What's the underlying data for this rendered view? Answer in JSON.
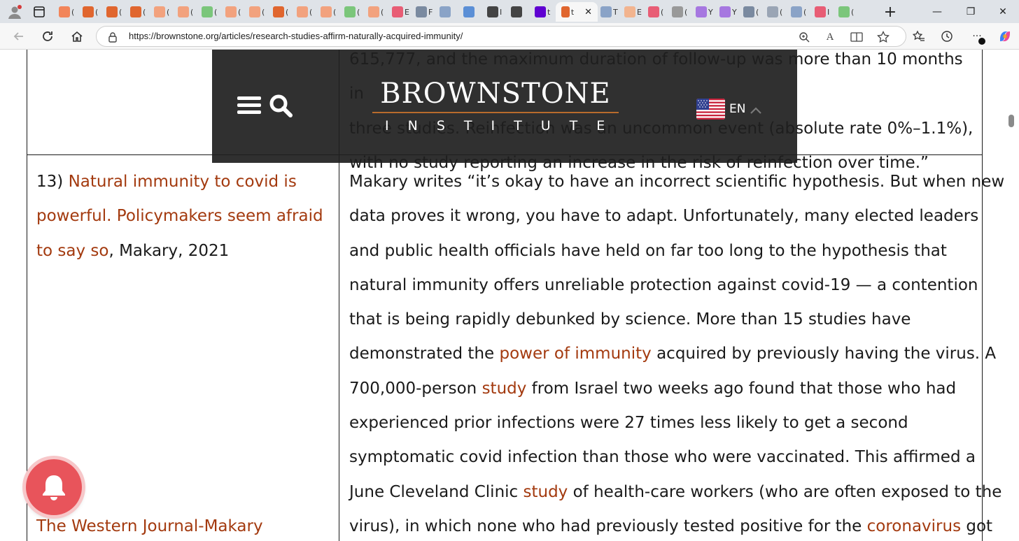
{
  "browser": {
    "tabs": [
      {
        "icon": "bookmark-icon",
        "color": "#f2855a",
        "label": "("
      },
      {
        "icon": "bookmark-icon",
        "color": "#e0662f",
        "label": "("
      },
      {
        "icon": "bookmark-icon",
        "color": "#e0662f",
        "label": "("
      },
      {
        "icon": "bookmark-icon",
        "color": "#e0662f",
        "label": "("
      },
      {
        "icon": "bookmark-icon",
        "color": "#f2a27e",
        "label": "("
      },
      {
        "icon": "bookmark-icon",
        "color": "#f2a27e",
        "label": "("
      },
      {
        "icon": "play-icon",
        "color": "#7bc67b",
        "label": "("
      },
      {
        "icon": "bookmark-icon",
        "color": "#f2a27e",
        "label": "("
      },
      {
        "icon": "bookmark-icon",
        "color": "#f2a27e",
        "label": "("
      },
      {
        "icon": "bookmark-icon",
        "color": "#e0662f",
        "label": "("
      },
      {
        "icon": "bookmark-icon",
        "color": "#f2a27e",
        "label": "("
      },
      {
        "icon": "bookmark-icon",
        "color": "#f2a27e",
        "label": "("
      },
      {
        "icon": "play-icon",
        "color": "#7bc67b",
        "label": "("
      },
      {
        "icon": "bookmark-icon",
        "color": "#f2a27e",
        "label": "("
      },
      {
        "icon": "video-icon",
        "color": "#e85d75",
        "label": "E"
      },
      {
        "icon": "news-icon",
        "color": "#7a8aa0",
        "label": "F"
      },
      {
        "icon": "doc-icon",
        "color": "#8aa3c7",
        "label": ""
      },
      {
        "icon": "search-icon",
        "color": "#5b8fd6",
        "label": ""
      },
      {
        "icon": "slash-icon",
        "color": "#444444",
        "label": "I"
      },
      {
        "icon": "slash-icon",
        "color": "#444444",
        "label": ""
      },
      {
        "icon": "yahoo-icon",
        "color": "#5f01d1",
        "label": "t"
      }
    ],
    "active_tab": {
      "icon": "bookmark-icon",
      "label": "t",
      "close": "✕"
    },
    "tabs_after": [
      {
        "icon": "gp-icon",
        "color": "#8aa3c7",
        "label": "T"
      },
      {
        "icon": "bookmark-icon",
        "color": "#f2b48f",
        "label": "E"
      },
      {
        "icon": "video-icon",
        "color": "#e85d75",
        "label": "("
      },
      {
        "icon": "face-icon",
        "color": "#999999",
        "label": "("
      },
      {
        "icon": "yahoo-icon",
        "color": "#a677e0",
        "label": "Y"
      },
      {
        "icon": "yahoo-icon",
        "color": "#a677e0",
        "label": "Y"
      },
      {
        "icon": "news-icon",
        "color": "#7a8aa0",
        "label": "("
      },
      {
        "icon": "doc-icon",
        "color": "#9aa5b5",
        "label": "("
      },
      {
        "icon": "web-icon",
        "color": "#8aa3c7",
        "label": "("
      },
      {
        "icon": "video-icon",
        "color": "#e85d75",
        "label": "I"
      },
      {
        "icon": "play-icon",
        "color": "#7bc67b",
        "label": "("
      }
    ],
    "new_tab": "+",
    "window_controls": {
      "minimize": "—",
      "restore": "❐",
      "close": "✕"
    },
    "url": "https://brownstone.org/articles/research-studies-affirm-naturally-acquired-immunity/"
  },
  "site": {
    "logo_word": "BROWNSTONE",
    "logo_sub": "INSTITUTE",
    "language": "EN",
    "accent_color": "#a33a0f"
  },
  "article": {
    "prev_row_text_lines": [
      "615,777, and the maximum duration of follow-up was more than 10 months in",
      "three studies. Reinfection was an uncommon event (absolute rate 0%–1.1%),",
      "with no study reporting an increase in the risk of reinfection over time.”"
    ],
    "row13": {
      "number": "13)",
      "title_link_lines": [
        "Natural immunity to covid is",
        "powerful. Policymakers seem afraid",
        "to say so"
      ],
      "citation": ", Makary, 2021",
      "footer_link": "The Western Journal-Makary",
      "body": [
        [
          {
            "t": "Makary writes “it’s okay to have an incorrect scientific hypothesis. But when new"
          }
        ],
        [
          {
            "t": "data proves it wrong, you have to adapt. Unfortunately, many elected leaders"
          }
        ],
        [
          {
            "t": "and public health officials have held on far too long to the hypothesis that"
          }
        ],
        [
          {
            "t": "natural immunity offers unreliable protection against covid-19 — a contention"
          }
        ],
        [
          {
            "t": "that is being rapidly debunked by science. More than 15 studies have"
          }
        ],
        [
          {
            "t": "demonstrated the "
          },
          {
            "t": "power of immunity",
            "link": true
          },
          {
            "t": " acquired by previously having the virus. A"
          }
        ],
        [
          {
            "t": "700,000-person "
          },
          {
            "t": "study",
            "link": true
          },
          {
            "t": " from Israel two weeks ago found that those who had"
          }
        ],
        [
          {
            "t": "experienced prior infections were 27 times less likely to get a second"
          }
        ],
        [
          {
            "t": "symptomatic covid infection than those who were vaccinated. This affirmed a"
          }
        ],
        [
          {
            "t": "June Cleveland Clinic "
          },
          {
            "t": "study",
            "link": true
          },
          {
            "t": " of health-care workers (who are often exposed to the"
          }
        ],
        [
          {
            "t": "virus), in which none who had previously tested positive for the "
          },
          {
            "t": "coronavirus",
            "link": true
          },
          {
            "t": " got"
          }
        ]
      ]
    }
  }
}
